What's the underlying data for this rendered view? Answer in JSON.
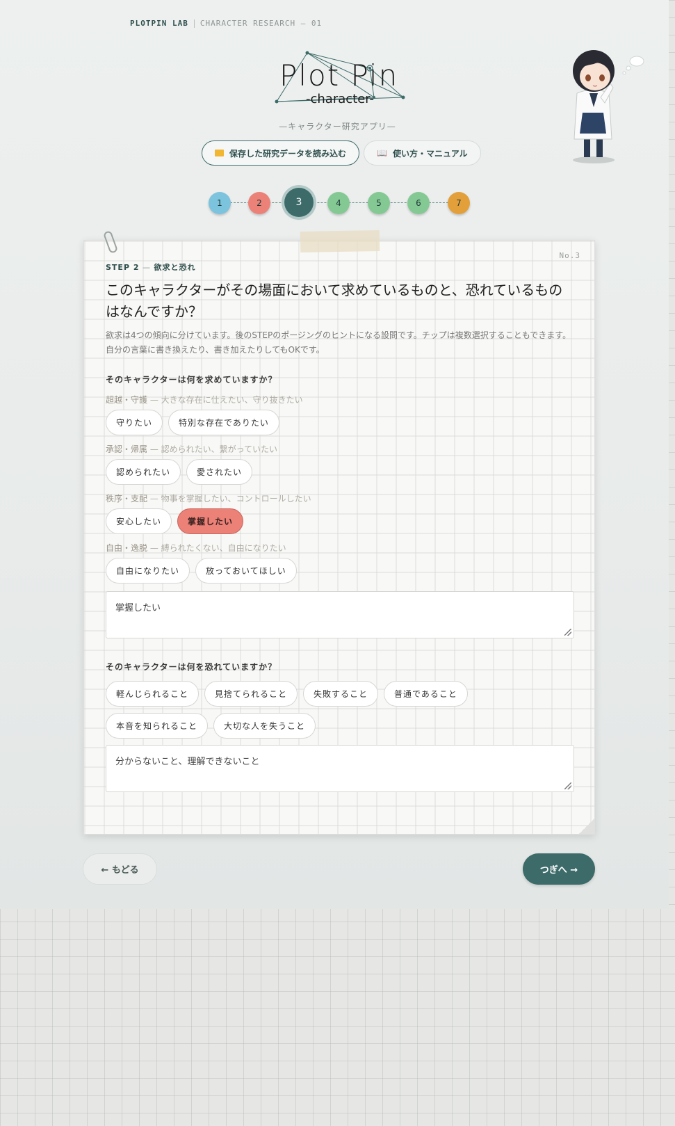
{
  "header": {
    "brand": "PLOTPIN LAB",
    "subtitle": "CHARACTER RESEARCH — 01"
  },
  "logo": {
    "title": "Plot Pin",
    "subtitle": "-character-"
  },
  "tagline": "—キャラクター研究アプリ—",
  "top_buttons": {
    "load_label": "保存した研究データを読み込む",
    "manual_label": "使い方・マニュアル"
  },
  "steps": [
    {
      "label": "1",
      "color": "#7cc3dd"
    },
    {
      "label": "2",
      "color": "#ec8178"
    },
    {
      "label": "3",
      "color": "#3c6b69"
    },
    {
      "label": "4",
      "color": "#84c994"
    },
    {
      "label": "5",
      "color": "#84c994"
    },
    {
      "label": "6",
      "color": "#84c994"
    },
    {
      "label": "7",
      "color": "#e3a03a"
    }
  ],
  "active_step": "3",
  "card": {
    "number": "No.3",
    "step_label": "STEP 2",
    "step_sep": " — ",
    "step_name": "欲求と恐れ",
    "question": "このキャラクターがその場面において求めているものと、恐れているものはなんですか？",
    "description": "欲求は4つの傾向に分けています。後のSTEPのポージングのヒントになる設問です。チップは複数選択することもできます。自分の言葉に書き換えたり、書き加えたりしてもOKです。",
    "wants": {
      "title": "そのキャラクターは何を求めていますか？",
      "categories": [
        {
          "name": "超越・守護",
          "sub": " — 大きな存在に仕えたい、守り抜きたい",
          "chips": [
            "守りたい",
            "特別な存在でありたい"
          ]
        },
        {
          "name": "承認・帰属",
          "sub": " — 認められたい、繋がっていたい",
          "chips": [
            "認められたい",
            "愛されたい"
          ]
        },
        {
          "name": "秩序・支配",
          "sub": " — 物事を掌握したい、コントロールしたい",
          "chips": [
            "安心したい",
            "掌握したい"
          ]
        },
        {
          "name": "自由・逸脱",
          "sub": " — 縛られたくない、自由になりたい",
          "chips": [
            "自由になりたい",
            "放っておいてほしい"
          ]
        }
      ],
      "selected": "掌握したい",
      "text": "掌握したい"
    },
    "fears": {
      "title": "そのキャラクターは何を恐れていますか？",
      "chips": [
        "軽んじられること",
        "見捨てられること",
        "失敗すること",
        "普通であること",
        "本音を知られること",
        "大切な人を失うこと"
      ],
      "text": "分からないこと、理解できないこと"
    }
  },
  "nav": {
    "back_label": "← もどる",
    "next_label": "つぎへ →"
  },
  "icons": {
    "load": "folder-icon",
    "manual": "book-icon"
  }
}
